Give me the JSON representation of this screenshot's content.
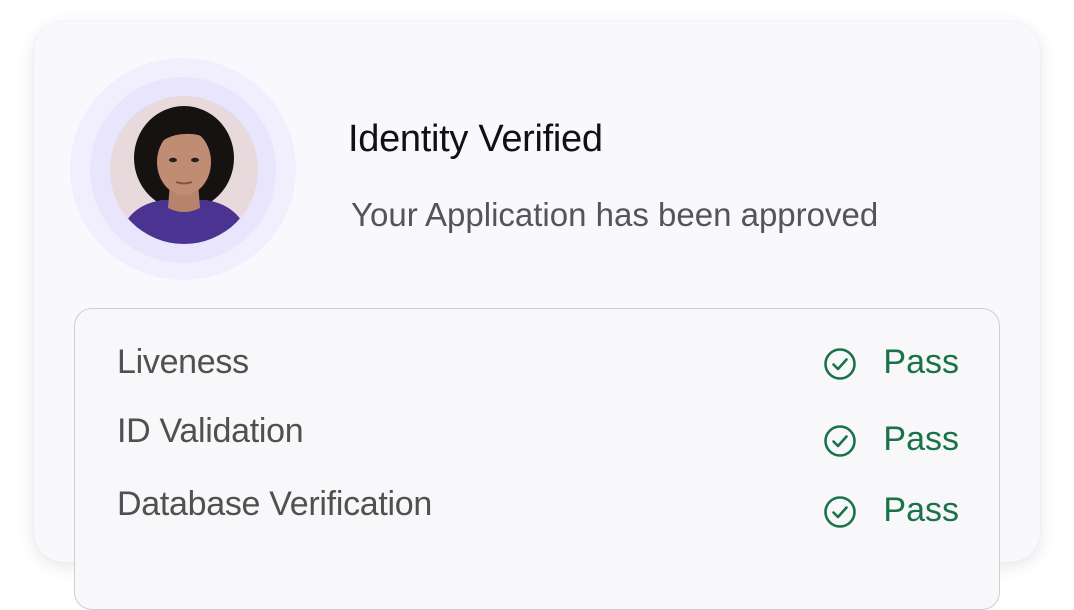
{
  "header": {
    "title": "Identity Verified",
    "subtitle": "Your Application has been approved"
  },
  "avatar": {
    "icon": "user-photo"
  },
  "checks": [
    {
      "label": "Liveness",
      "status": "Pass",
      "icon": "check-circle-icon"
    },
    {
      "label": "ID Validation",
      "status": "Pass",
      "icon": "check-circle-icon"
    },
    {
      "label": "Database Verification",
      "status": "Pass",
      "icon": "check-circle-icon"
    }
  ],
  "colors": {
    "card_bg": "#f9f8fd",
    "ring_outer": "#f1effd",
    "ring_inner": "#e9e5fd",
    "pass_green": "#1a7348",
    "title": "#111111",
    "subtitle": "#555555"
  }
}
